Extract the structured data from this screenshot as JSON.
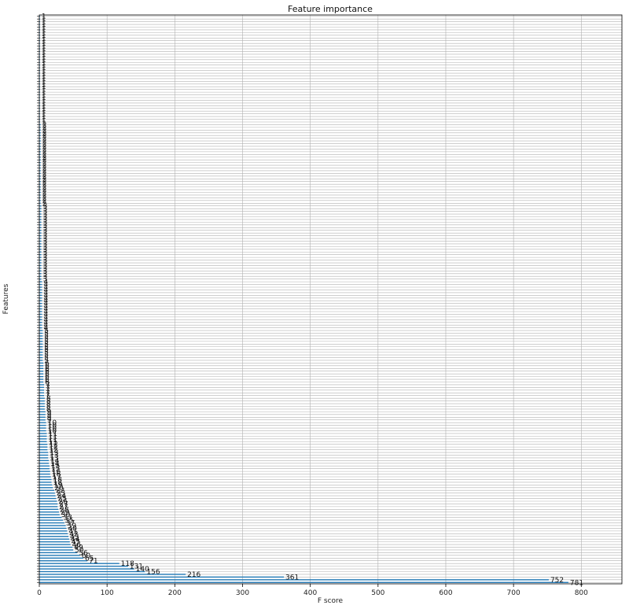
{
  "chart_data": {
    "type": "bar",
    "orientation": "horizontal",
    "title": "Feature importance",
    "xlabel": "F score",
    "ylabel": "Features",
    "xlim": [
      0,
      860
    ],
    "x_ticks": [
      0,
      100,
      200,
      300,
      400,
      500,
      600,
      700,
      800
    ],
    "grid": true,
    "bar_color": "#1f77b4",
    "values": [
      781,
      752,
      361,
      216,
      156,
      140,
      131,
      118,
      71,
      65,
      60,
      56,
      50,
      49,
      46,
      45,
      44,
      43,
      42,
      41,
      40,
      39,
      37,
      35,
      33,
      30,
      29,
      28,
      27,
      27,
      26,
      25,
      24,
      23,
      22,
      20,
      19,
      18,
      18,
      17,
      16,
      16,
      15,
      15,
      14,
      14,
      13,
      13,
      13,
      12,
      12,
      12,
      11,
      11,
      11,
      11,
      10,
      10,
      10,
      10,
      9,
      9,
      9,
      9,
      8,
      8,
      8,
      8,
      8,
      7,
      7,
      7,
      7,
      7,
      6,
      6,
      6,
      6,
      6,
      6,
      6,
      6,
      5,
      5,
      5,
      5,
      5,
      5,
      5,
      5,
      5,
      5,
      5,
      5,
      4,
      4,
      4,
      4,
      4,
      4,
      4,
      4,
      4,
      4,
      4,
      4,
      4,
      4,
      4,
      4,
      4,
      4,
      3,
      3,
      3,
      3,
      3,
      3,
      3,
      3,
      3,
      3,
      3,
      3,
      3,
      3,
      3,
      3,
      3,
      3,
      3,
      3,
      3,
      3,
      3,
      3,
      3,
      3,
      3,
      3,
      2,
      2,
      2,
      2,
      2,
      2,
      2,
      2,
      2,
      2,
      2,
      2,
      2,
      2,
      2,
      2,
      2,
      2,
      2,
      2,
      2,
      2,
      2,
      2,
      2,
      2,
      2,
      2,
      2,
      2,
      1,
      1,
      1,
      1,
      1,
      1,
      1,
      1,
      1,
      1,
      1,
      1,
      1,
      1,
      1,
      1,
      1,
      1,
      1,
      1,
      1,
      1,
      1,
      1,
      1,
      1,
      1,
      1,
      1,
      1,
      1,
      1,
      1,
      1,
      1,
      1,
      1,
      1,
      1,
      1
    ]
  }
}
